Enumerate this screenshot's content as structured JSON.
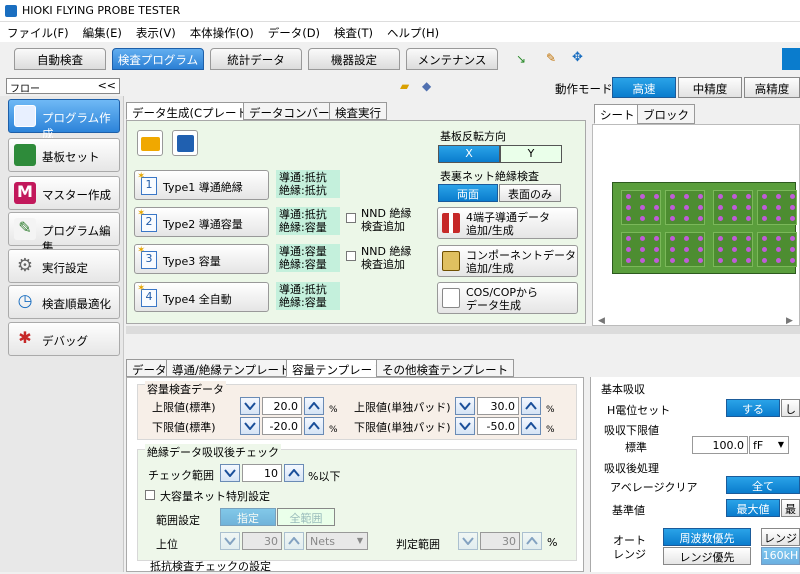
{
  "window": {
    "title": "HIOKI FLYING PROBE TESTER"
  },
  "menu": [
    "ファイル(F)",
    "編集(E)",
    "表示(V)",
    "本体操作(O)",
    "データ(D)",
    "検査(T)",
    "ヘルプ(H)"
  ],
  "main_tabs": [
    "自動検査",
    "検査プログラム",
    "統計データ",
    "機器設定",
    "メンテナンス"
  ],
  "mode": {
    "label": "動作モード",
    "options": [
      "高速",
      "中精度",
      "高精度"
    ],
    "selected": "高速"
  },
  "left": {
    "header": "フロー",
    "collapse": "<<",
    "items": [
      "プログラム作成",
      "基板セット",
      "マスター作成",
      "プログラム編集",
      "実行設定",
      "検査順最適化",
      "デバッグ"
    ]
  },
  "upper_tabs": [
    "データ生成(Cプレート)",
    "データコンバート",
    "検査実行"
  ],
  "types": [
    {
      "num": "1",
      "label": "Type1 導通絶縁",
      "info1": "導通:抵抗",
      "info2": "絶縁:抵抗"
    },
    {
      "num": "2",
      "label": "Type2 導通容量",
      "info1": "導通:抵抗",
      "info2": "絶縁:容量"
    },
    {
      "num": "3",
      "label": "Type3 容量",
      "info1": "導通:容量",
      "info2": "絶縁:容量"
    },
    {
      "num": "4",
      "label": "Type4 全自動",
      "info1": "導通:抵抗",
      "info2": "絶縁:容量"
    }
  ],
  "nnd": {
    "line1": "NND 絶縁",
    "line2": "検査追加"
  },
  "flip": {
    "label": "基板反転方向",
    "x": "X",
    "y": "Y"
  },
  "surface": {
    "label": "表裏ネット絶縁検査",
    "both": "両面",
    "front": "表面のみ"
  },
  "side_buttons": [
    {
      "l1": "4端子導通データ",
      "l2": "追加/生成"
    },
    {
      "l1": "コンポーネントデータ",
      "l2": "追加/生成"
    },
    {
      "l1": "COS/COPから",
      "l2": "データ生成"
    }
  ],
  "sheet_tabs": [
    "シート",
    "ブロック"
  ],
  "lower_tabs": [
    "データ",
    "導通/絶縁テンプレート",
    "容量テンプレート",
    "その他検査テンプレート"
  ],
  "capacity": {
    "title": "容量検査データ",
    "upper_std_label": "上限値(標準)",
    "upper_std": "20.0",
    "lower_std_label": "下限値(標準)",
    "lower_std": "-20.0",
    "upper_pad_label": "上限値(単独パッド)",
    "upper_pad": "30.0",
    "lower_pad_label": "下限値(単独パッド)",
    "lower_pad": "-50.0",
    "unit": "%"
  },
  "insulation_check": {
    "title": "絶縁データ吸収後チェック",
    "range_label": "チェック範囲",
    "range_value": "10",
    "range_unit": "%以下",
    "large_net_label": "大容量ネット特別設定",
    "scope_label": "範囲設定",
    "scope_selected": "指定",
    "scope_all": "全範囲",
    "top_label": "上位",
    "top_value": "30",
    "top_unit": "Nets",
    "judge_label": "判定範囲",
    "judge_value": "30",
    "judge_unit": "%"
  },
  "resist_title": "抵抗検査チェックの設定",
  "basic_absorb": {
    "title": "基本吸収",
    "h_label": "H電位セット",
    "h_on": "する",
    "h_off": "し",
    "lower_title": "吸収下限値",
    "std_label": "標準",
    "std_value": "100.0",
    "std_unit": "fF",
    "post_title": "吸収後処理",
    "avg_label": "アベレージクリア",
    "avg_value": "全て",
    "ref_label": "基準値",
    "ref_value": "最大値",
    "ref_alt": "最",
    "auto_label1": "オート",
    "auto_label2": "レンジ",
    "freq_pri": "周波数優先",
    "range_pri": "レンジ優先",
    "range_btn": "レンジ",
    "freq_val": "160kH"
  },
  "colors": {
    "accent": "#0a7ccd",
    "panel": "#ecf7e8",
    "green_label": "#c4f0dc"
  }
}
